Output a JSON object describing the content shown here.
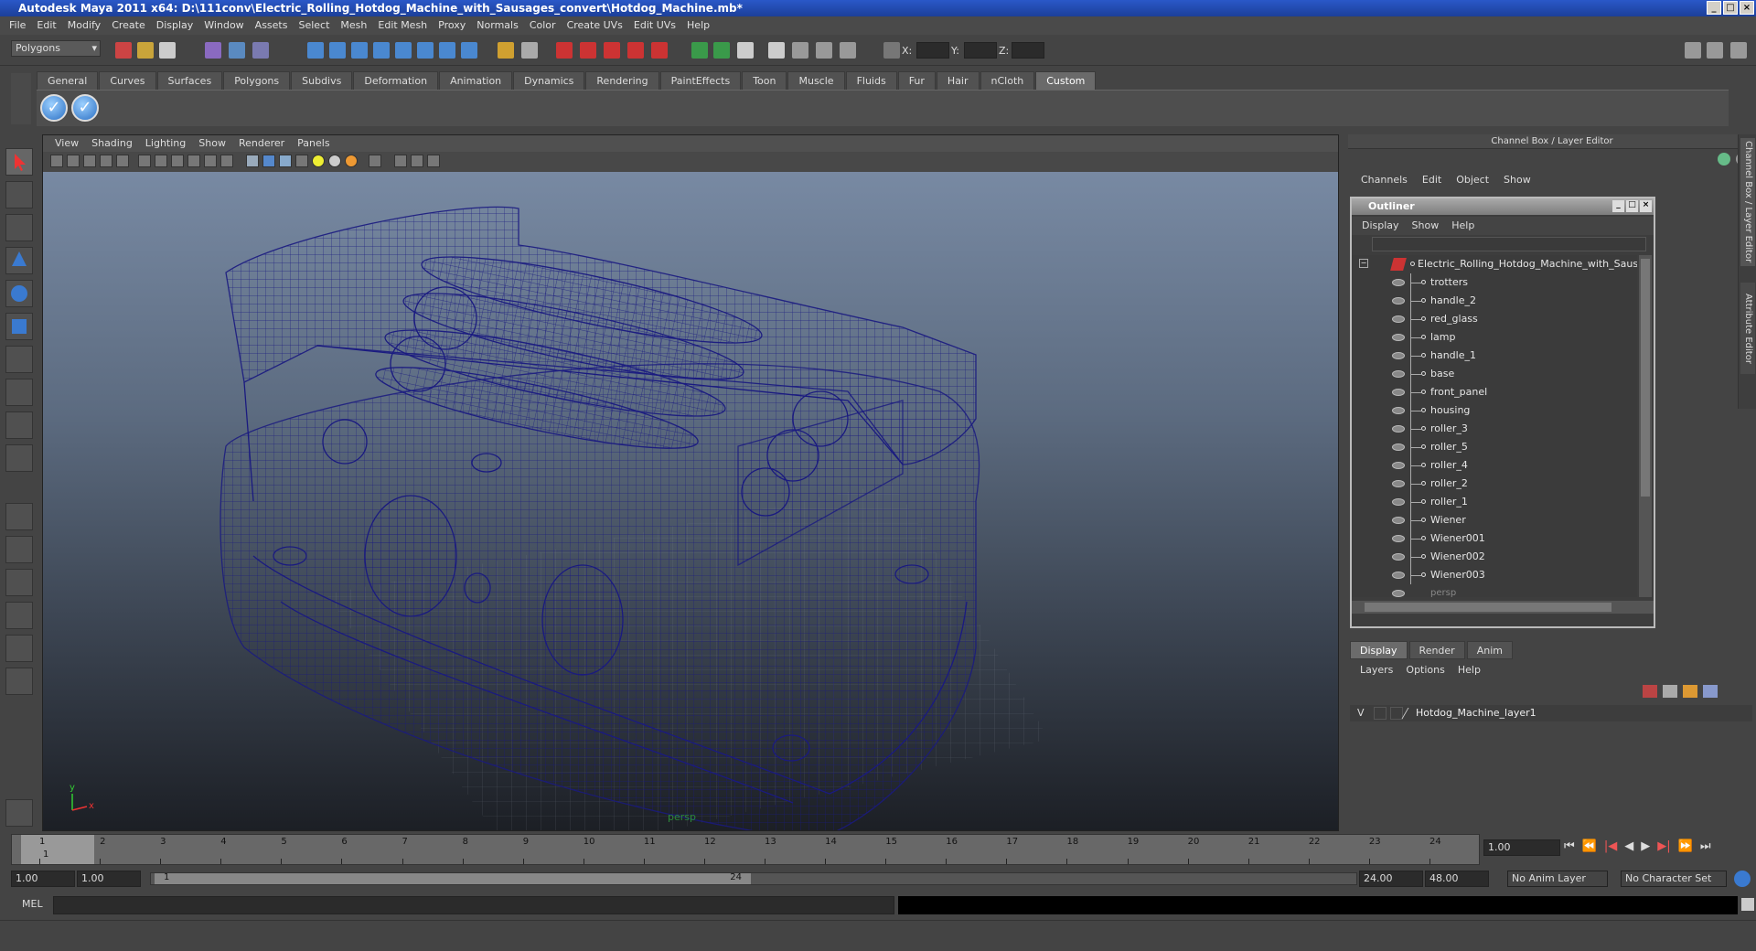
{
  "window": {
    "title": "Autodesk Maya 2011 x64: D:\\111conv\\Electric_Rolling_Hotdog_Machine_with_Sausages_convert\\Hotdog_Machine.mb*"
  },
  "menubar": [
    "File",
    "Edit",
    "Modify",
    "Create",
    "Display",
    "Window",
    "Assets",
    "Select",
    "Mesh",
    "Edit Mesh",
    "Proxy",
    "Normals",
    "Color",
    "Create UVs",
    "Edit UVs",
    "Help"
  ],
  "statusline": {
    "mode": "Polygons",
    "x_label": "X:",
    "y_label": "Y:",
    "z_label": "Z:"
  },
  "shelf": {
    "tabs": [
      "General",
      "Curves",
      "Surfaces",
      "Polygons",
      "Subdivs",
      "Deformation",
      "Animation",
      "Dynamics",
      "Rendering",
      "PaintEffects",
      "Toon",
      "Muscle",
      "Fluids",
      "Fur",
      "Hair",
      "nCloth",
      "Custom"
    ],
    "active_tab": "Custom"
  },
  "viewport": {
    "menu": [
      "View",
      "Shading",
      "Lighting",
      "Show",
      "Renderer",
      "Panels"
    ],
    "camera_label": "persp",
    "axis_y": "y",
    "axis_x": "x"
  },
  "channel_box": {
    "title": "Channel Box / Layer Editor",
    "menu": [
      "Channels",
      "Edit",
      "Object",
      "Show"
    ],
    "side_tabs": [
      "Channel Box / Layer Editor",
      "Attribute Editor"
    ]
  },
  "outliner": {
    "title": "Outliner",
    "menu": [
      "Display",
      "Show",
      "Help"
    ],
    "root": "Electric_Rolling_Hotdog_Machine_with_Sausages",
    "items": [
      "trotters",
      "handle_2",
      "red_glass",
      "lamp",
      "handle_1",
      "base",
      "front_panel",
      "housing",
      "roller_3",
      "roller_5",
      "roller_4",
      "roller_2",
      "roller_1",
      "Wiener",
      "Wiener001",
      "Wiener002",
      "Wiener003"
    ],
    "partial_item": "persp"
  },
  "layer_editor": {
    "tabs": [
      "Display",
      "Render",
      "Anim"
    ],
    "active_tab": "Display",
    "menu": [
      "Layers",
      "Options",
      "Help"
    ],
    "layer_visible": "V",
    "layer_name": "Hotdog_Machine_layer1"
  },
  "timeline": {
    "ticks": [
      "1",
      "2",
      "3",
      "4",
      "5",
      "6",
      "7",
      "8",
      "9",
      "10",
      "11",
      "12",
      "13",
      "14",
      "15",
      "16",
      "17",
      "18",
      "19",
      "20",
      "21",
      "22",
      "23",
      "24"
    ],
    "current_frame_marker": "1",
    "current_time": "1.00"
  },
  "range": {
    "start": "1.00",
    "playback_start": "1.00",
    "slider_start": "1",
    "slider_end": "24",
    "playback_end": "24.00",
    "end": "48.00",
    "anim_layer": "No Anim Layer",
    "character_set": "No Character Set"
  },
  "command_line": {
    "language": "MEL"
  },
  "colors": {
    "wireframe": "#1a1a80",
    "title_bar": "#2a58c8",
    "panel": "#444444"
  }
}
